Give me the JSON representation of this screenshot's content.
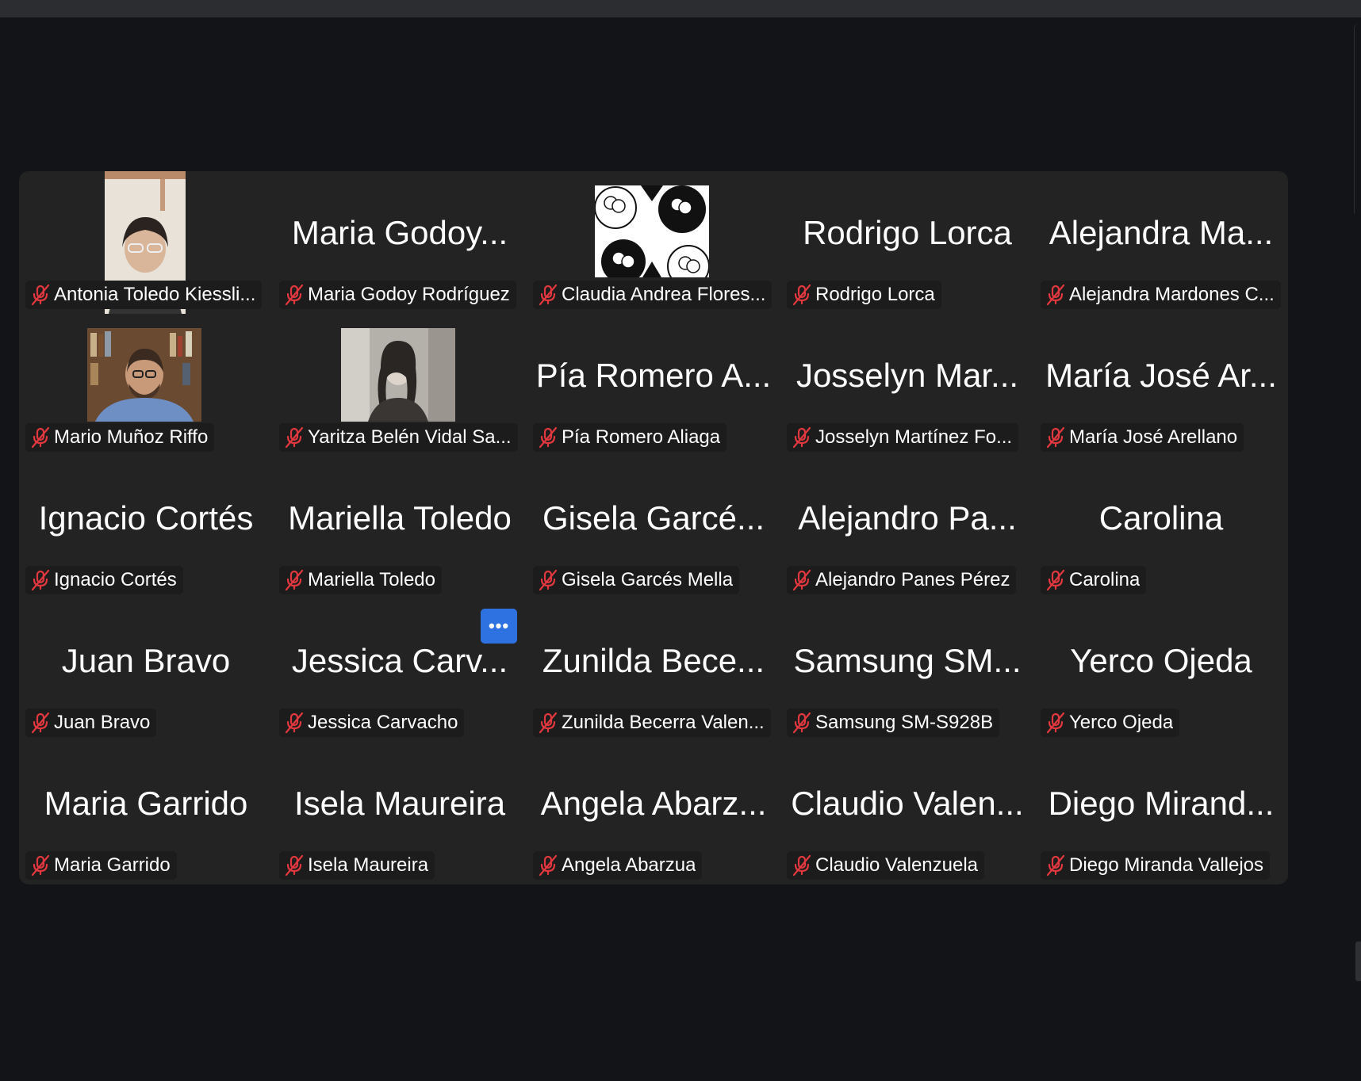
{
  "participants": [
    {
      "display": "",
      "label": "Antonia Toledo Kiessli...",
      "has_video": true,
      "video_icon": "person-with-glasses-video"
    },
    {
      "display": "Maria Godoy...",
      "label": "Maria Godoy Rodríguez"
    },
    {
      "display": "",
      "label": "Claudia Andrea Flores...",
      "has_video": true,
      "video_icon": "sheep-pattern-avatar"
    },
    {
      "display": "Rodrigo Lorca",
      "label": "Rodrigo Lorca"
    },
    {
      "display": "Alejandra Ma...",
      "label": "Alejandra Mardones C..."
    },
    {
      "display": "",
      "label": "Mario Muñoz Riffo",
      "has_video": true,
      "video_icon": "man-bookshelf-video"
    },
    {
      "display": "",
      "label": "Yaritza Belén Vidal Sa...",
      "has_video": true,
      "video_icon": "woman-grayscale-video"
    },
    {
      "display": "Pía Romero A...",
      "label": "Pía Romero Aliaga"
    },
    {
      "display": "Josselyn Mar...",
      "label": "Josselyn Martínez Fo..."
    },
    {
      "display": "María José Ar...",
      "label": "María José Arellano"
    },
    {
      "display": "Ignacio Cortés",
      "label": "Ignacio Cortés"
    },
    {
      "display": "Mariella Toledo",
      "label": "Mariella Toledo"
    },
    {
      "display": "Gisela Garcé...",
      "label": "Gisela Garcés Mella"
    },
    {
      "display": "Alejandro Pa...",
      "label": "Alejandro Panes Pérez"
    },
    {
      "display": "Carolina",
      "label": "Carolina"
    },
    {
      "display": "Juan Bravo",
      "label": "Juan Bravo"
    },
    {
      "display": "Jessica Carv...",
      "label": "Jessica Carvacho"
    },
    {
      "display": "Zunilda Bece...",
      "label": "Zunilda Becerra Valen..."
    },
    {
      "display": "Samsung SM...",
      "label": "Samsung SM-S928B"
    },
    {
      "display": "Yerco Ojeda",
      "label": "Yerco Ojeda"
    },
    {
      "display": "Maria Garrido",
      "label": "Maria Garrido"
    },
    {
      "display": "Isela Maureira",
      "label": "Isela Maureira"
    },
    {
      "display": "Angela Abarz...",
      "label": "Angela Abarzua"
    },
    {
      "display": "Claudio Valen...",
      "label": "Claudio Valenzuela"
    },
    {
      "display": "Diego Mirand...",
      "label": "Diego Miranda Vallejos"
    }
  ],
  "more_button": {
    "label": "•••",
    "icon": "more-options-icon"
  },
  "colors": {
    "background": "#131417",
    "gallery": "#232323",
    "muted_mic": "#e0383e",
    "accent": "#2d72e0"
  }
}
